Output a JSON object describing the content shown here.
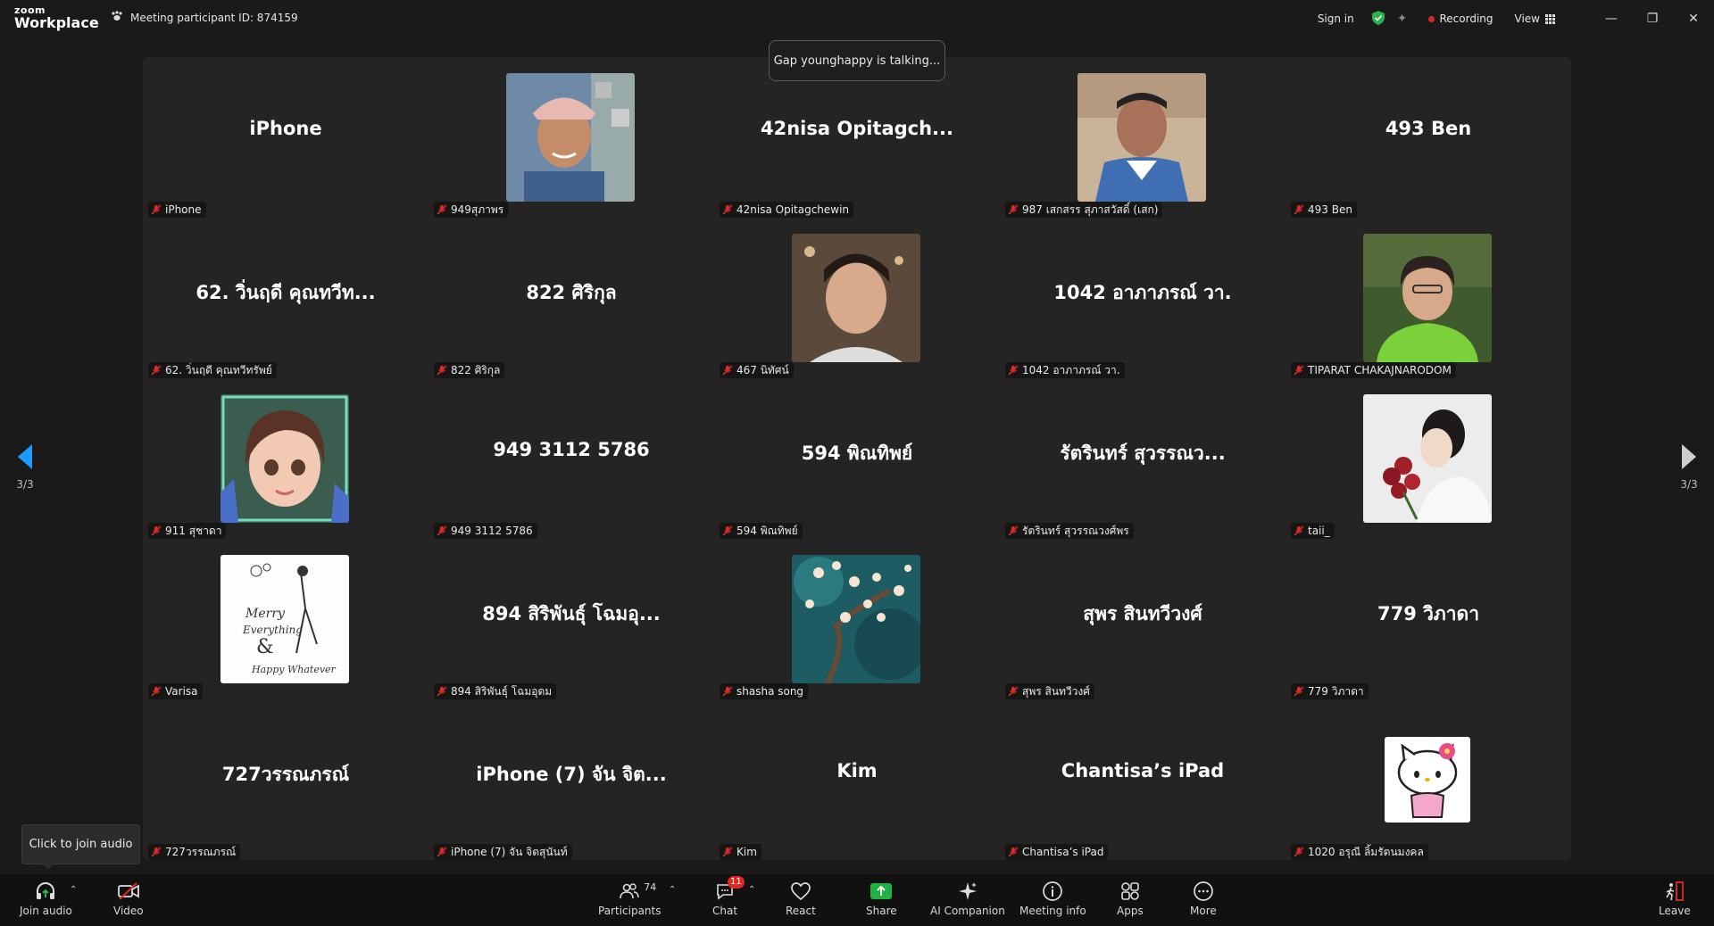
{
  "titlebar": {
    "brand_top": "zoom",
    "brand_bottom": "Workplace",
    "meeting_id": "Meeting participant ID: 874159",
    "sign_in": "Sign in",
    "recording": "Recording",
    "view": "View"
  },
  "toast": "Gap younghappy is talking...",
  "pager": {
    "left": "3/3",
    "right": "3/3"
  },
  "tooltip": "Click to join audio",
  "tiles": [
    {
      "big": "iPhone",
      "name": "iPhone",
      "avatar": ""
    },
    {
      "big": "",
      "name": "949สุภาพร",
      "avatar": "photo-woman-cap"
    },
    {
      "big": "42nisa Opitagch...",
      "name": "42nisa Opitagchewin",
      "avatar": ""
    },
    {
      "big": "",
      "name": "987 เสกสรร สุภาสวัสดิ์ (เสก)",
      "avatar": "photo-man-older"
    },
    {
      "big": "493 Ben",
      "name": "493 Ben",
      "avatar": ""
    },
    {
      "big": "62. วิ่นฤดี คุณทวีท...",
      "name": "62. วิ่นฤดี คุณทวีทรัพย์",
      "avatar": ""
    },
    {
      "big": "822 ศิริกุล",
      "name": "822 ศิริกุล",
      "avatar": ""
    },
    {
      "big": "",
      "name": "467 นิทัศน์",
      "avatar": "photo-young-man"
    },
    {
      "big": "1042 อาภาภรณ์ วา.",
      "name": "1042 อาภาภรณ์ วา.",
      "avatar": ""
    },
    {
      "big": "",
      "name": "TIPARAT CHAKAJNARODOM",
      "avatar": "photo-woman-green"
    },
    {
      "big": "",
      "name": "911 สุชาดา",
      "avatar": "cartoon-girl"
    },
    {
      "big": "949 3112 5786",
      "name": "949 3112 5786",
      "avatar": ""
    },
    {
      "big": "594 พิณทิพย์",
      "name": "594 พิณทิพย์",
      "avatar": ""
    },
    {
      "big": "รัตรินทร์ สุวรรณว...",
      "name": "รัตรินทร์ สุวรรณวงศ์พร",
      "avatar": ""
    },
    {
      "big": "",
      "name": "taii_",
      "avatar": "photo-woman-roses"
    },
    {
      "big": "",
      "name": "Varisa",
      "avatar": "card-merry"
    },
    {
      "big": "894 สิริพันธุ์ โฉมอุ...",
      "name": "894 สิริพันธุ์ โฉมอุดม",
      "avatar": ""
    },
    {
      "big": "",
      "name": "shasha song",
      "avatar": "painting-blossom"
    },
    {
      "big": "สุพร สินทวีวงศ์",
      "name": "สุพร สินทวีวงศ์",
      "avatar": ""
    },
    {
      "big": "779 วิภาดา",
      "name": "779 วิภาดา",
      "avatar": ""
    },
    {
      "big": "727วรรณภรณ์",
      "name": "727วรรณภรณ์",
      "avatar": ""
    },
    {
      "big": "iPhone (7) จัน จิต...",
      "name": "iPhone (7) จัน จิตสุนันท์",
      "avatar": ""
    },
    {
      "big": "Kim",
      "name": "Kim",
      "avatar": ""
    },
    {
      "big": "Chantisa’s iPad",
      "name": "Chantisa’s iPad",
      "avatar": ""
    },
    {
      "big": "",
      "name": "1020 อรุณี ลิ้มรัตนมงคล",
      "avatar": "hello-kitty"
    }
  ],
  "toolbar": {
    "join_audio": "Join audio",
    "video": "Video",
    "participants": "Participants",
    "participants_count": "74",
    "chat": "Chat",
    "chat_badge": "11",
    "react": "React",
    "share": "Share",
    "ai_companion": "AI Companion",
    "meeting_info": "Meeting info",
    "apps": "Apps",
    "more": "More",
    "leave": "Leave"
  },
  "colors": {
    "accent_blue": "#1f9bff",
    "record_red": "#e02828",
    "share_green": "#1fb141",
    "shield_green": "#2bb24c"
  }
}
